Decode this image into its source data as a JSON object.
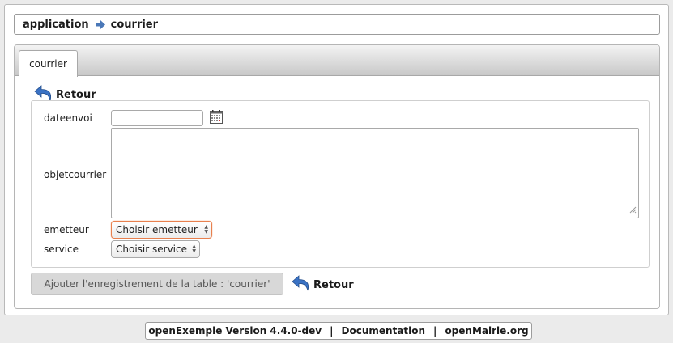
{
  "breadcrumb": {
    "items": [
      "application",
      "courrier"
    ],
    "separator_icon": "arrow-right-icon"
  },
  "tabs": [
    {
      "label": "courrier",
      "active": true
    }
  ],
  "retour_top": {
    "label": "Retour",
    "icon": "back-arrow-icon"
  },
  "form": {
    "dateenvoi": {
      "label": "dateenvoi",
      "value": "",
      "icon": "calendar-icon"
    },
    "objetcourrier": {
      "label": "objetcourrier",
      "value": ""
    },
    "emetteur": {
      "label": "emetteur",
      "selected": "Choisir emetteur"
    },
    "service": {
      "label": "service",
      "selected": "Choisir service"
    }
  },
  "submit": {
    "label": "Ajouter l'enregistrement de la table : 'courrier'"
  },
  "retour_bottom": {
    "label": "Retour",
    "icon": "back-arrow-icon"
  },
  "footer": {
    "version": "openExemple Version 4.4.0-dev",
    "documentation": "Documentation",
    "site": "openMairie.org"
  },
  "colors": {
    "focus_border": "#e8804e",
    "icon_blue": "#3a72c4"
  }
}
